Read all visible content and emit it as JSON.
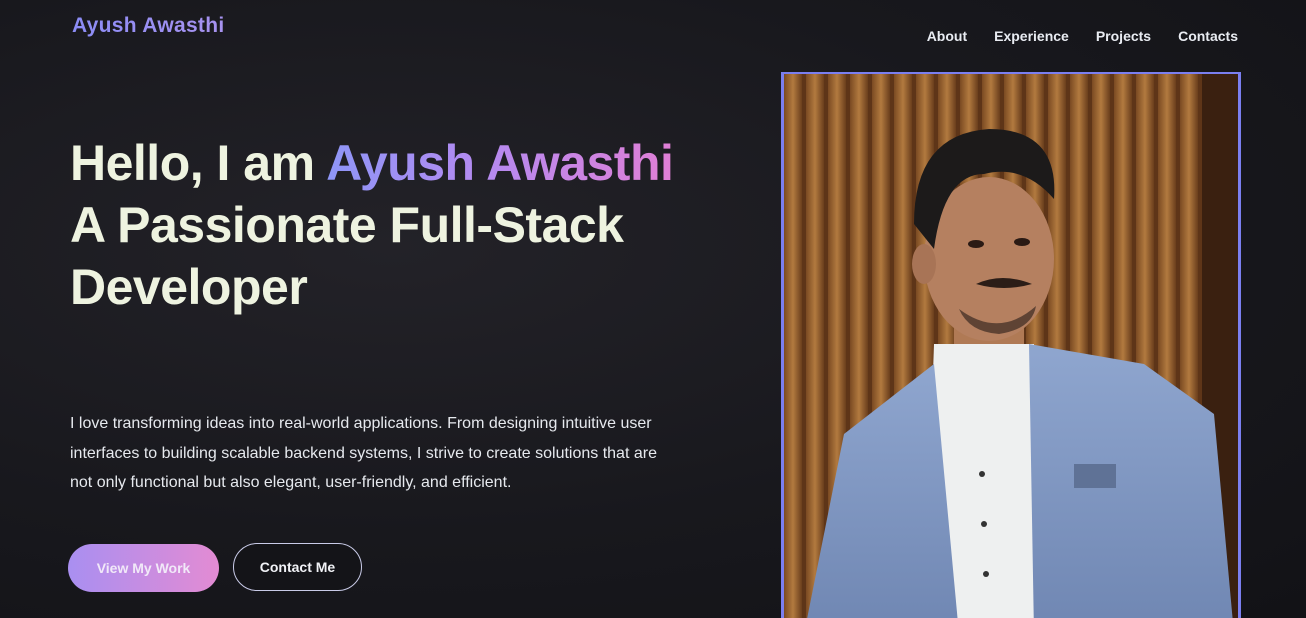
{
  "header": {
    "logo": "Ayush Awasthi",
    "nav": [
      "About",
      "Experience",
      "Projects",
      "Contacts"
    ]
  },
  "hero": {
    "greeting": "Hello, I am ",
    "name": "Ayush Awasthi",
    "tagline": "A Passionate Full-Stack Developer",
    "description": "I love transforming ideas into real-world applications. From designing intuitive user interfaces to building scalable backend systems, I strive to create solutions that are not only functional but also elegant, user-friendly, and efficient.",
    "primary_button": "View My Work",
    "secondary_button": "Contact Me"
  },
  "colors": {
    "accent": "#7b7ff0",
    "gradient_start": "#8e96f7",
    "gradient_end": "#e07fd6",
    "background": "#18181d"
  }
}
